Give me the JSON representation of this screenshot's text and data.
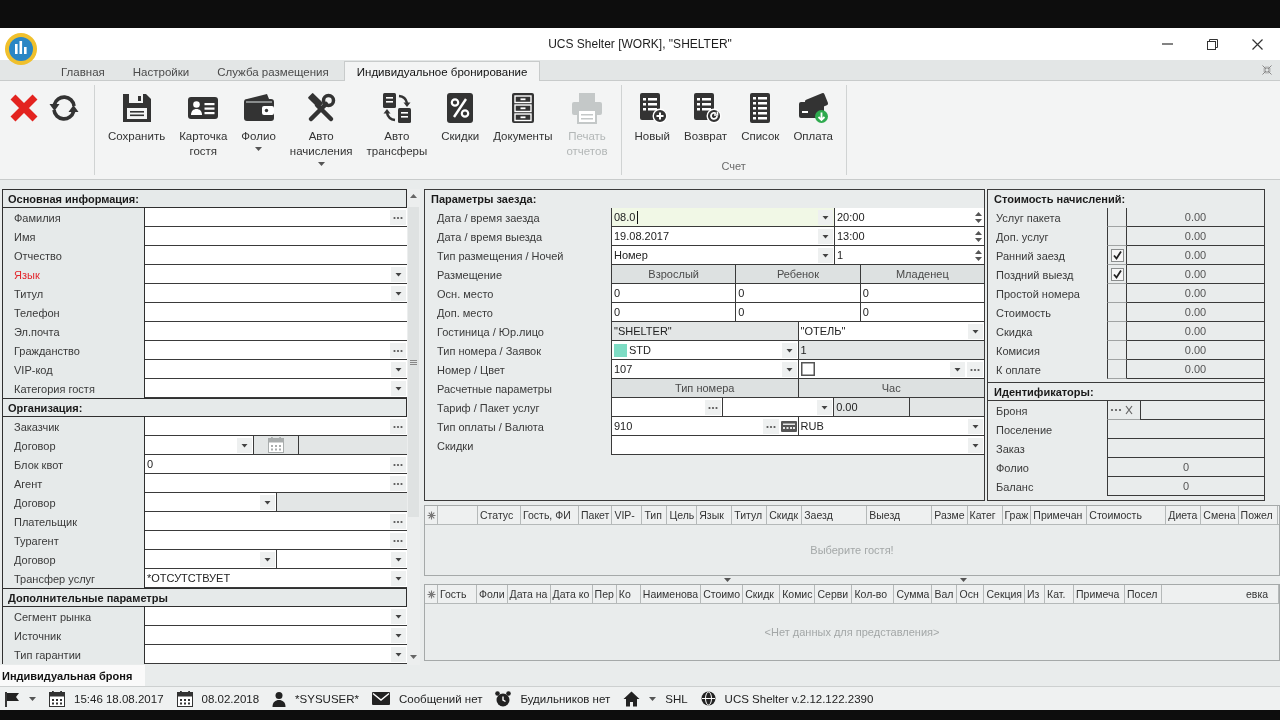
{
  "window": {
    "title": "UCS Shelter [WORK], \"SHELTER\""
  },
  "ribbon_tabs": [
    {
      "label": "Главная",
      "selected": false
    },
    {
      "label": "Настройки",
      "selected": false
    },
    {
      "label": "Служба размещения",
      "selected": false
    },
    {
      "label": "Индивидуальное бронирование",
      "selected": true
    }
  ],
  "ribbon": {
    "groups": [
      {
        "buttons": [
          {
            "kind": "close",
            "disabled": false
          },
          {
            "kind": "refresh",
            "disabled": false
          }
        ]
      },
      {
        "buttons": [
          {
            "kind": "save",
            "label": "Сохранить",
            "dropdown": false,
            "disabled": false
          },
          {
            "kind": "guest_card",
            "label": "Карточка гостя",
            "dropdown": false,
            "disabled": false
          },
          {
            "kind": "folio",
            "label": "Фолио",
            "dropdown": true,
            "disabled": false
          },
          {
            "kind": "auto_charges",
            "label": "Авто начисления",
            "dropdown": true,
            "disabled": false
          },
          {
            "kind": "auto_transfers",
            "label": "Авто трансферы",
            "dropdown": false,
            "disabled": false
          },
          {
            "kind": "discounts",
            "label": "Скидки",
            "dropdown": false,
            "disabled": false
          },
          {
            "kind": "documents",
            "label": "Документы",
            "dropdown": false,
            "disabled": false
          },
          {
            "kind": "print",
            "label": "Печать отчетов",
            "dropdown": false,
            "disabled": true
          }
        ]
      },
      {
        "label": "Счет",
        "buttons": [
          {
            "kind": "new_invoice",
            "label": "Новый",
            "dropdown": false,
            "disabled": false
          },
          {
            "kind": "refund",
            "label": "Возврат",
            "dropdown": false,
            "disabled": false
          },
          {
            "kind": "invoice_list",
            "label": "Список",
            "dropdown": false,
            "disabled": false
          },
          {
            "kind": "payment",
            "label": "Оплата",
            "dropdown": false,
            "disabled": false
          }
        ]
      }
    ]
  },
  "guest_form": {
    "sections": [
      {
        "title": "Основная информация:",
        "fields": [
          {
            "label": "Фамилия",
            "required": false,
            "inputs": [
              {
                "kind": "lookup"
              }
            ]
          },
          {
            "label": "Имя",
            "required": false,
            "inputs": [
              {
                "kind": "text"
              }
            ]
          },
          {
            "label": "Отчество",
            "required": false,
            "inputs": [
              {
                "kind": "text"
              }
            ]
          },
          {
            "label": "Язык",
            "required": true,
            "inputs": [
              {
                "kind": "select"
              }
            ]
          },
          {
            "label": "Титул",
            "required": false,
            "inputs": [
              {
                "kind": "select"
              }
            ]
          },
          {
            "label": "Телефон",
            "required": false,
            "inputs": [
              {
                "kind": "text"
              }
            ]
          },
          {
            "label": "Эл.почта",
            "required": false,
            "inputs": [
              {
                "kind": "text"
              }
            ]
          },
          {
            "label": "Гражданство",
            "required": false,
            "inputs": [
              {
                "kind": "lookup"
              }
            ]
          },
          {
            "label": "VIP-код",
            "required": false,
            "inputs": [
              {
                "kind": "select"
              }
            ]
          },
          {
            "label": "Категория гостя",
            "required": false,
            "inputs": [
              {
                "kind": "select"
              }
            ]
          }
        ]
      },
      {
        "title": "Организация:",
        "fields": [
          {
            "label": "Заказчик",
            "required": false,
            "inputs": [
              {
                "kind": "lookup"
              }
            ]
          },
          {
            "label": "Договор",
            "required": false,
            "inputs": [
              {
                "kind": "select"
              },
              {
                "kind": "calendar"
              },
              {
                "kind": "readonly"
              }
            ]
          },
          {
            "label": "Блок квот",
            "required": false,
            "inputs": [
              {
                "kind": "lookup",
                "value": "0"
              }
            ]
          },
          {
            "label": "Агент",
            "required": false,
            "inputs": [
              {
                "kind": "lookup"
              }
            ]
          },
          {
            "label": "Договор",
            "required": false,
            "inputs": [
              {
                "kind": "select"
              },
              {
                "kind": "readonly"
              }
            ]
          },
          {
            "label": "Плательщик",
            "required": false,
            "inputs": [
              {
                "kind": "lookup"
              }
            ]
          },
          {
            "label": "Турагент",
            "required": false,
            "inputs": [
              {
                "kind": "lookup"
              }
            ]
          },
          {
            "label": "Договор",
            "required": false,
            "inputs": [
              {
                "kind": "select"
              },
              {
                "kind": "select"
              }
            ]
          },
          {
            "label": "Трансфер услуг",
            "required": false,
            "inputs": [
              {
                "kind": "select",
                "value": "*ОТСУТСТВУЕТ"
              }
            ]
          }
        ]
      },
      {
        "title": "Дополнительные параметры",
        "fields": [
          {
            "label": "Сегмент рынка",
            "required": false,
            "inputs": [
              {
                "kind": "select"
              }
            ]
          },
          {
            "label": "Источник",
            "required": false,
            "inputs": [
              {
                "kind": "select"
              }
            ]
          },
          {
            "label": "Тип гарантии",
            "required": false,
            "inputs": [
              {
                "kind": "select"
              }
            ]
          }
        ]
      }
    ]
  },
  "stay_params": {
    "title": "Параметры заезда:",
    "rows": [
      {
        "kind": "fields",
        "label": "Дата / время заезда",
        "inputs": [
          {
            "kind": "select",
            "value": "08.0",
            "focused": true
          },
          {
            "kind": "spin",
            "value": "20:00",
            "focused": false
          }
        ]
      },
      {
        "kind": "fields",
        "label": "Дата / время выезда",
        "inputs": [
          {
            "kind": "select",
            "value": "19.08.2017",
            "focused": false
          },
          {
            "kind": "spin",
            "value": "13:00",
            "focused": false
          }
        ]
      },
      {
        "kind": "fields",
        "label": "Тип размещения / Ночей",
        "inputs": [
          {
            "kind": "select",
            "value": "Номер",
            "focused": false
          },
          {
            "kind": "spin",
            "value": "1",
            "focused": false
          }
        ]
      },
      {
        "kind": "header",
        "label": "Размещение",
        "columns": [
          "Взрослый",
          "Ребенок",
          "Младенец"
        ]
      },
      {
        "kind": "fields",
        "label": "Осн. место",
        "inputs": [
          {
            "kind": "text",
            "value": "0",
            "focused": false
          },
          {
            "kind": "text",
            "value": "0",
            "focused": false
          },
          {
            "kind": "text",
            "value": "0",
            "focused": false
          }
        ]
      },
      {
        "kind": "fields",
        "label": "Доп. место",
        "inputs": [
          {
            "kind": "text",
            "value": "0",
            "focused": false
          },
          {
            "kind": "text",
            "value": "0",
            "focused": false
          },
          {
            "kind": "text",
            "value": "0",
            "focused": false
          }
        ]
      },
      {
        "kind": "fields",
        "label": "Гостиница / Юр.лицо",
        "inputs": [
          {
            "kind": "readonly",
            "value": "\"SHELTER\"",
            "focused": false
          },
          {
            "kind": "select",
            "value": "\"ОТЕЛЬ\"",
            "focused": false
          }
        ]
      },
      {
        "kind": "fields",
        "label": "Тип номера / Заявок",
        "inputs": [
          {
            "kind": "select",
            "value": "STD",
            "color": "#7ddcc4",
            "focused": false
          },
          {
            "kind": "readonly",
            "value": "1",
            "focused": false
          }
        ]
      },
      {
        "kind": "fields",
        "label": "Номер / Цвет",
        "inputs": [
          {
            "kind": "select",
            "value": "107",
            "focused": false
          },
          {
            "kind": "select_lookup",
            "focused": false
          }
        ]
      },
      {
        "kind": "header",
        "label": "Расчетные параметры",
        "columns": [
          "Тип номера",
          "Час"
        ]
      },
      {
        "kind": "fields",
        "label": "Тариф / Пакет услуг",
        "inputs": [
          {
            "kind": "lookup",
            "focused": false
          },
          {
            "kind": "select",
            "focused": false
          },
          {
            "kind": "readonly",
            "value": "0.00",
            "focused": false
          },
          {
            "kind": "readonly",
            "focused": false
          }
        ]
      },
      {
        "kind": "fields",
        "label": "Тип оплаты / Валюта",
        "inputs": [
          {
            "kind": "lookup_card",
            "value": "910",
            "focused": false
          },
          {
            "kind": "select",
            "value": "RUB",
            "focused": false
          }
        ]
      },
      {
        "kind": "fields",
        "label": "Скидки",
        "inputs": [
          {
            "kind": "select",
            "focused": false
          }
        ]
      }
    ]
  },
  "charges": {
    "title": "Стоимость начислений:",
    "rows": [
      {
        "label": "Услуг пакета",
        "checked": false,
        "value": "0.00"
      },
      {
        "label": "Доп. услуг",
        "checked": false,
        "value": "0.00"
      },
      {
        "label": "Ранний заезд",
        "checked": true,
        "value": "0.00"
      },
      {
        "label": "Поздний выезд",
        "checked": true,
        "value": "0.00"
      },
      {
        "label": "Простой номера",
        "checked": false,
        "value": "0.00"
      },
      {
        "label": "Стоимость",
        "checked": false,
        "value": "0.00"
      },
      {
        "label": "Скидка",
        "checked": false,
        "value": "0.00"
      },
      {
        "label": "Комисия",
        "checked": false,
        "value": "0.00"
      },
      {
        "label": "К оплате",
        "checked": false,
        "value": "0.00"
      }
    ]
  },
  "identifiers": {
    "title": "Идентификаторы:",
    "rows": [
      {
        "label": "Броня",
        "kind": "lookup"
      },
      {
        "label": "Поселение",
        "kind": "field"
      },
      {
        "label": "Заказ",
        "kind": "field"
      },
      {
        "label": "Фолио",
        "kind": "field",
        "value": "0"
      },
      {
        "label": "Баланс",
        "kind": "field",
        "value": "0"
      }
    ]
  },
  "guests_grid": {
    "columns": [
      "Статус",
      "Гость, ФИ",
      "Пакет",
      "VIP-",
      "Тип",
      "Цель",
      "Язык",
      "Титул",
      "Скидк",
      "Заезд",
      "Выезд",
      "Разме",
      "Катег",
      "Граж",
      "Примечан",
      "Стоимость",
      "Диета",
      "Смена",
      "Пожел"
    ],
    "empty_text": "Выберите гостя!"
  },
  "services_grid": {
    "columns": [
      "Гость",
      "Фоли",
      "Дата на",
      "Дата ко",
      "Пер",
      "Ко",
      "Наименова",
      "Стоимо",
      "Скидк",
      "Комис",
      "Серви",
      "Кол-во",
      "Сумма",
      "Вал",
      "Осн",
      "Секция",
      "Из",
      "Кат.",
      "Примеча",
      "Посел",
      "евка"
    ],
    "empty_text": "<Нет данных для представления>"
  },
  "document_tabs": [
    {
      "label": "Индивидуальная броня",
      "selected": true
    }
  ],
  "status_bar": {
    "items": [
      {
        "kind": "flag",
        "dropdown": true
      },
      {
        "kind": "datetime",
        "text": "15:46 18.08.2017",
        "dropdown": false
      },
      {
        "kind": "date",
        "text": "08.02.2018",
        "dropdown": false
      },
      {
        "kind": "user",
        "text": "*SYSUSER*",
        "dropdown": false
      },
      {
        "kind": "messages",
        "text": "Сообщений нет",
        "dropdown": false
      },
      {
        "kind": "alarms",
        "text": "Будильников нет",
        "dropdown": false
      },
      {
        "kind": "hotel",
        "text": "SHL",
        "dropdown": true
      },
      {
        "kind": "version",
        "text": "UCS Shelter v.2.12.122.2390",
        "dropdown": false
      }
    ]
  }
}
